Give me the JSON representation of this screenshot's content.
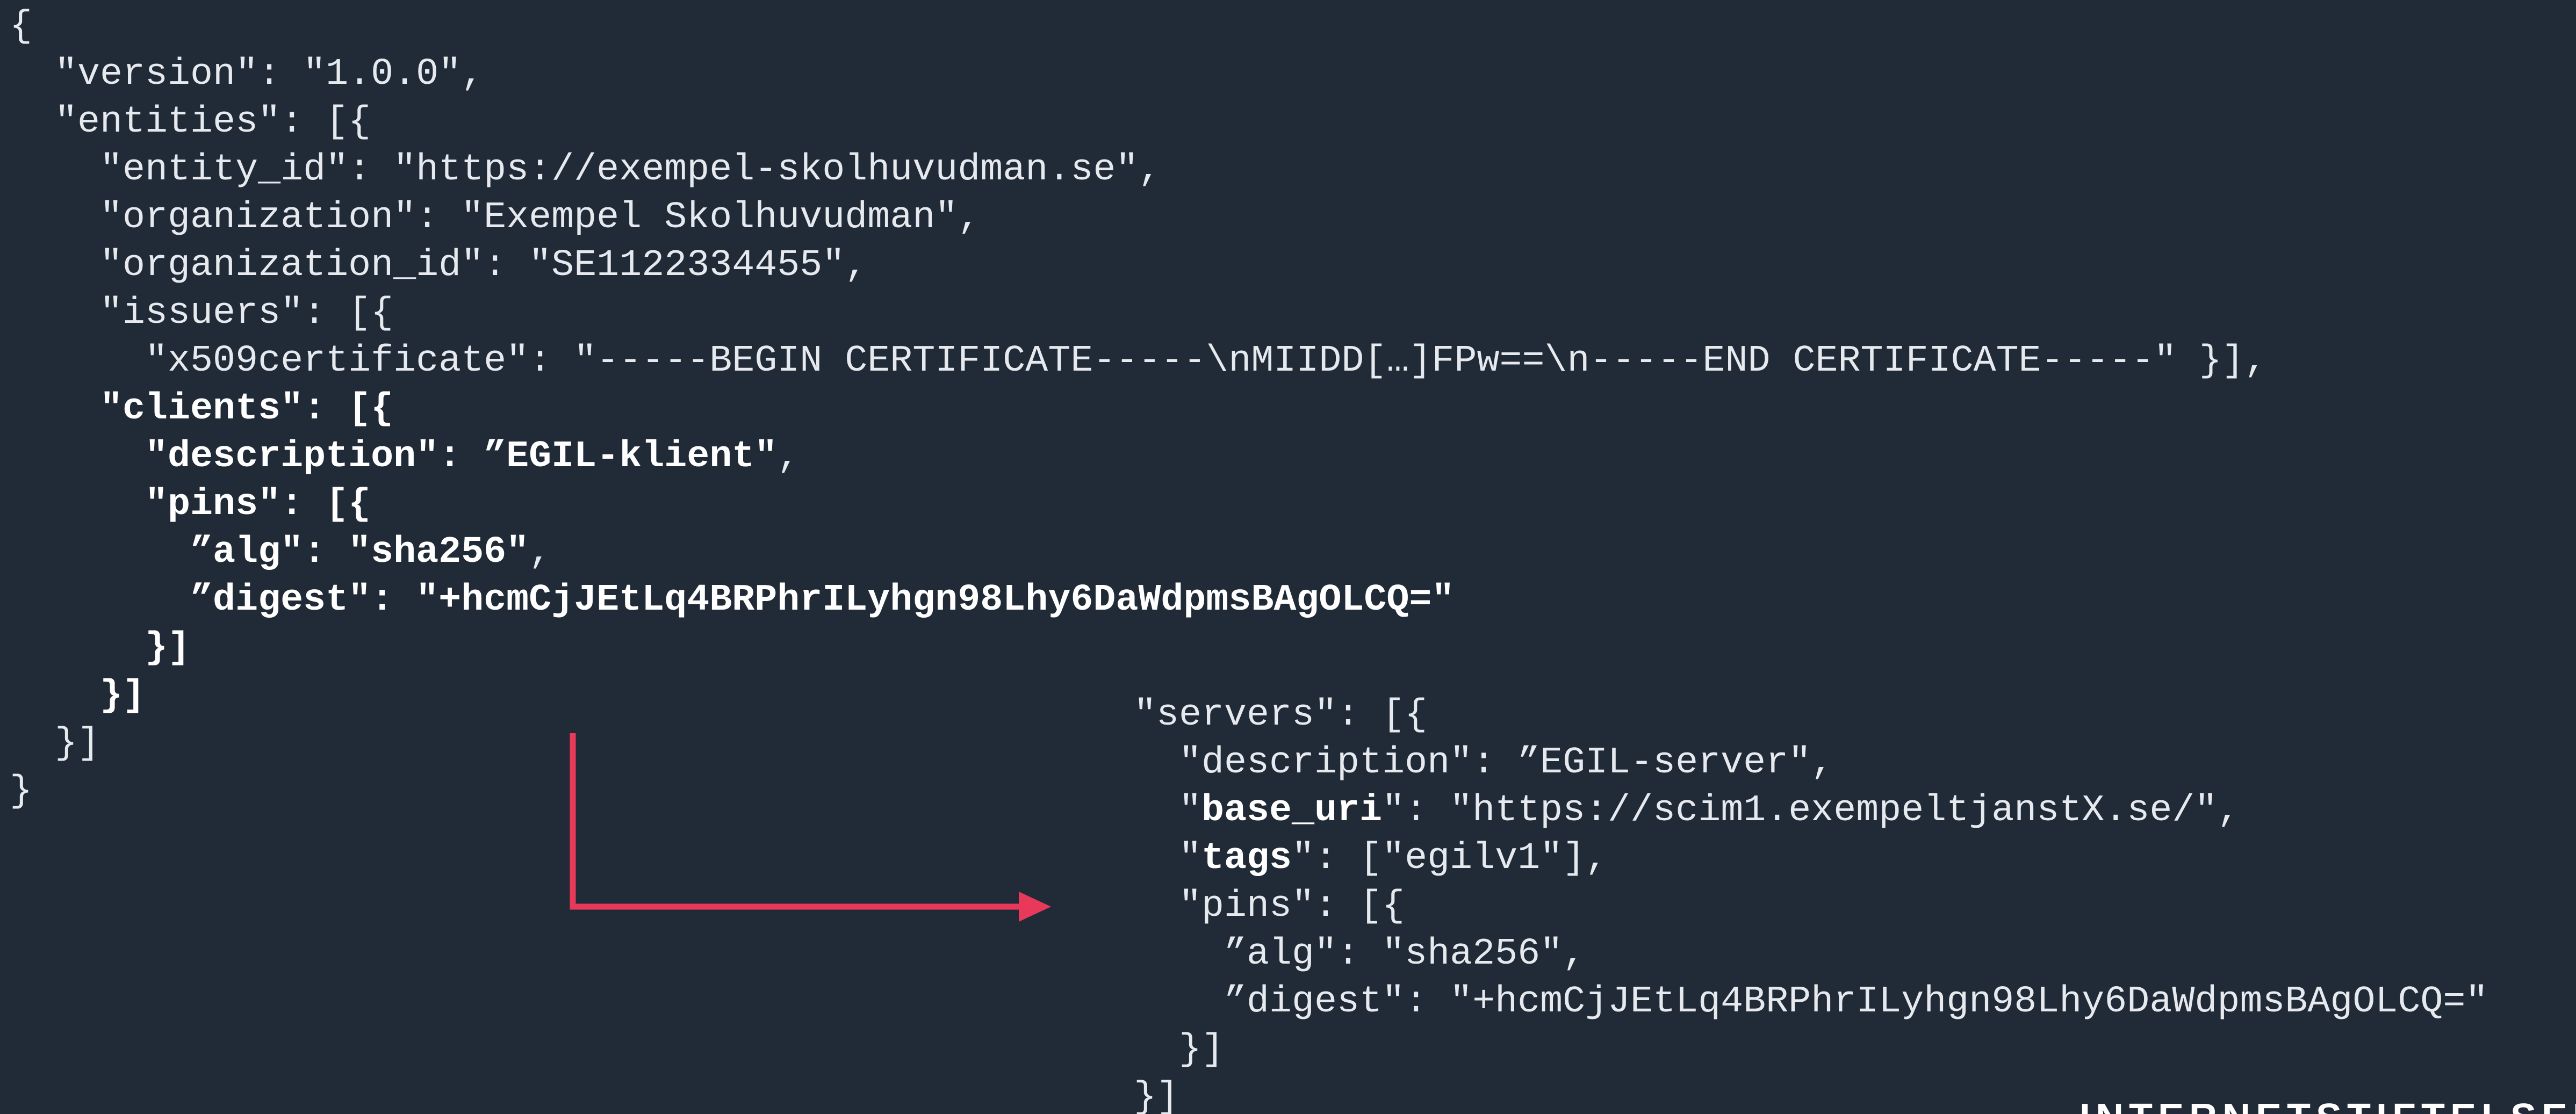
{
  "left_code": {
    "l01": "{",
    "l02": "  \"version\": \"1.0.0\",",
    "l03": "  \"entities\": [{",
    "l04": "    \"entity_id\": \"https://exempel-skolhuvudman.se\",",
    "l05": "    \"organization\": \"Exempel Skolhuvudman\",",
    "l06": "    \"organization_id\": \"SE1122334455\",",
    "l07": "    \"issuers\": [{",
    "l08": "      \"x509certificate\": \"-----BEGIN CERTIFICATE-----\\nMIIDD[…]FPw==\\n-----END CERTIFICATE-----\" }],",
    "l09": "    \"clients\": [{",
    "l10a": "      \"description\": ",
    "l10b": "”EGIL-klient\"",
    "l10c": ",",
    "l11": "      \"pins\": [{",
    "l12a": "        ”alg\": ",
    "l12b": "\"sha256\"",
    "l12c": ",",
    "l13a": "        ”digest\": ",
    "l13b": "\"+hcmCjJEtLq4BRPhrILyhgn98Lhy6DaWdpmsBAgOLCQ=\"",
    "l14": "      }]",
    "l15": "    }]",
    "l16": "  }]",
    "l17": "}"
  },
  "right_code": {
    "r01": "\"servers\": [{",
    "r02": "  \"description\": ”EGIL-server\",",
    "r03a": "  \"",
    "r03b": "base_uri",
    "r03c": "\": \"https://scim1.exempeltjanstX.se/\",",
    "r04a": "  \"",
    "r04b": "tags",
    "r04c": "\": [\"egilv1\"],",
    "r05": "  \"pins\": [{",
    "r06": "    ”alg\": \"sha256\",",
    "r07": "    ”digest\": \"+hcmCjJEtLq4BRPhrILyhgn98Lhy6DaWdpmsBAgOLCQ=\"",
    "r08": "  }]",
    "r09": "}]"
  },
  "footer": {
    "brand": "INTERNETSTIFTELSEN"
  },
  "colors": {
    "background": "#212a37",
    "text": "#e6e9ee",
    "arrow": "#e8395a"
  }
}
